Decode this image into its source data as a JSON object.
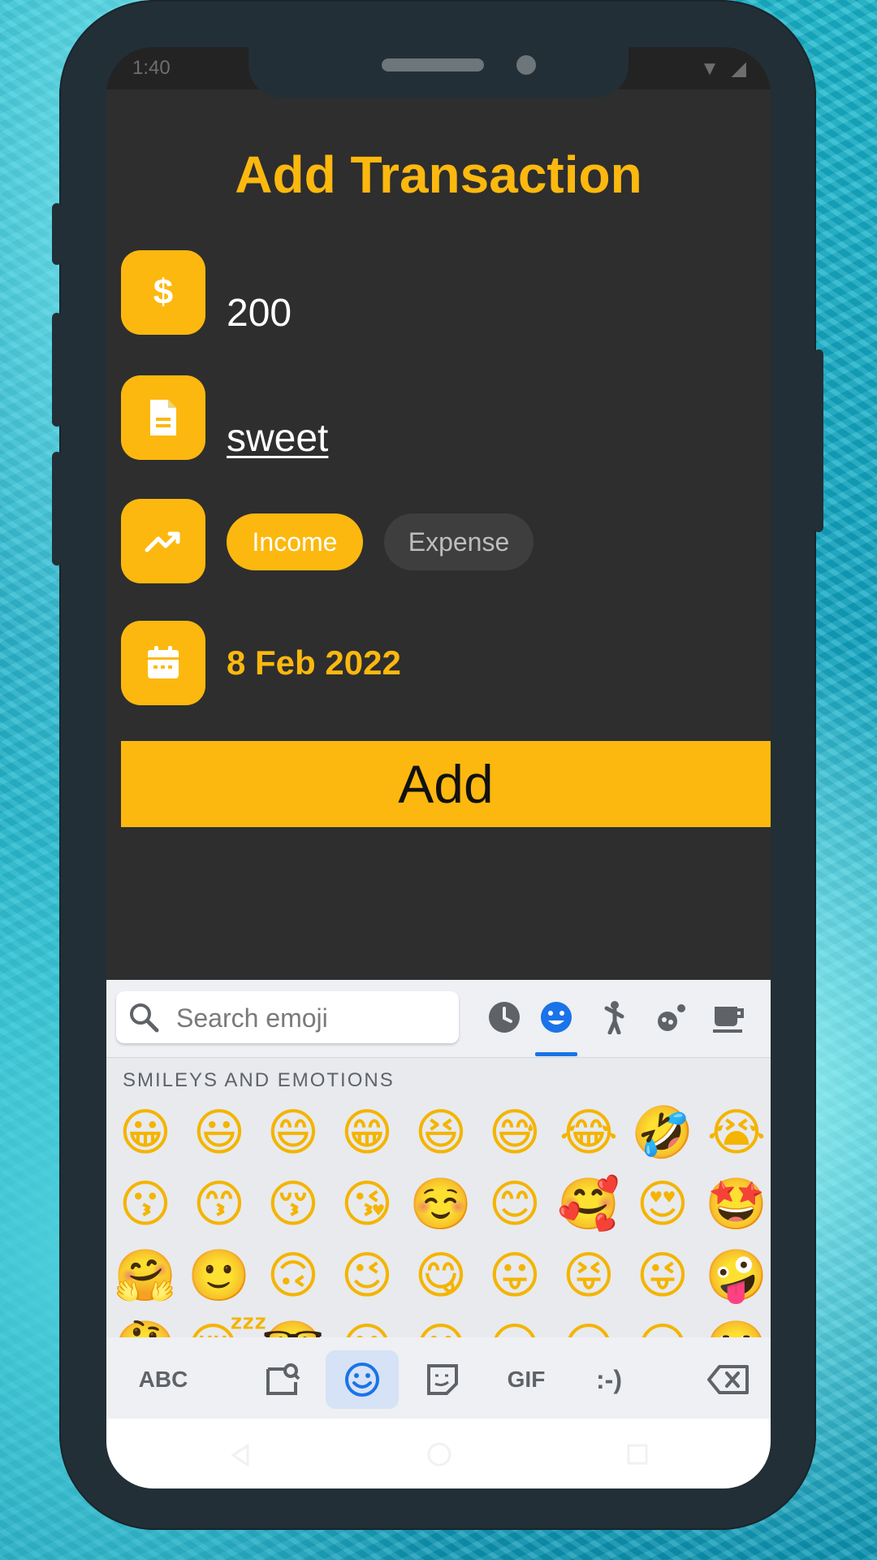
{
  "status_bar": {
    "time": "1:40"
  },
  "page": {
    "title": "Add Transaction"
  },
  "form": {
    "amount": {
      "icon": "dollar-icon",
      "value": "200"
    },
    "note": {
      "icon": "document-icon",
      "value": "sweet"
    },
    "type": {
      "icon": "trending-up-icon",
      "options": [
        "Income",
        "Expense"
      ],
      "selected": "Income"
    },
    "date": {
      "icon": "calendar-icon",
      "value": "8 Feb 2022"
    },
    "submit_label": "Add"
  },
  "keyboard": {
    "search_placeholder": "Search emoji",
    "categories": [
      "recent-icon",
      "smileys-icon",
      "people-activity-icon",
      "animals-nature-icon",
      "food-drink-icon"
    ],
    "active_category": "smileys-icon",
    "section_label": "SMILEYS AND EMOTIONS",
    "emoji_rows": [
      [
        "😀",
        "😃",
        "😄",
        "😁",
        "😆",
        "😅",
        "😂",
        "🤣",
        "😭"
      ],
      [
        "😗",
        "😙",
        "😚",
        "😘",
        "☺️",
        "😊",
        "🥰",
        "😍",
        "🤩"
      ],
      [
        "🤗",
        "🙂",
        "🙃",
        "😉",
        "😋",
        "😛",
        "😝",
        "😜",
        "🤪"
      ],
      [
        "🤔",
        "😴",
        "🤓",
        "😶",
        "😐",
        "😑",
        "😏",
        "😒",
        "🙄"
      ]
    ],
    "bottom_bar": {
      "abc_label": "ABC",
      "gif_label": "GIF",
      "emoticon_label": ":-)"
    }
  },
  "colors": {
    "accent": "#fcb80f",
    "background": "#2e2e2e",
    "chip_inactive": "#3e3e3e",
    "keyboard_accent": "#1a73e8"
  }
}
